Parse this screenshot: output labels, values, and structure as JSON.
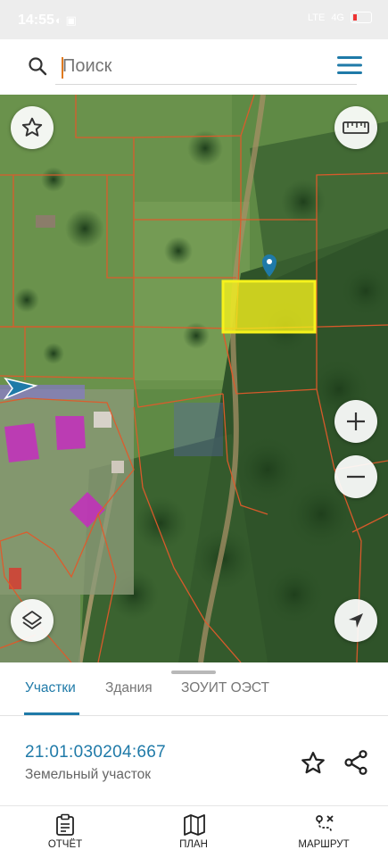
{
  "status_bar": {
    "time": "14:55",
    "notif_icons": "◐ ▣",
    "network": "LTE",
    "signal_label": "4G"
  },
  "search": {
    "placeholder": "Поиск",
    "value": "Поиск"
  },
  "map": {
    "icons": [
      "favorite-icon",
      "ruler-icon",
      "zoom-in-icon",
      "zoom-out-icon",
      "layers-icon",
      "locate-icon",
      "location-pin-icon",
      "direction-arrow-icon"
    ],
    "parcel_boundary_color": "#e05a2b",
    "selected_parcel_color": "#f6f21c",
    "building_color": "#c52cc0"
  },
  "sheet": {
    "tabs": [
      {
        "label": "Участки"
      },
      {
        "label": "Здания"
      },
      {
        "label": "ЗОУИТ ОЭСТ"
      }
    ],
    "active_tab": 0,
    "cadastral_number": "21:01:030204:667",
    "object_type": "Земельный участок"
  },
  "nav": [
    {
      "label": "ОТЧЁТ"
    },
    {
      "label": "ПЛАН"
    },
    {
      "label": "МАРШРУТ"
    }
  ],
  "colors": {
    "accent": "#1f7aa8",
    "selection": "#f6f21c"
  }
}
